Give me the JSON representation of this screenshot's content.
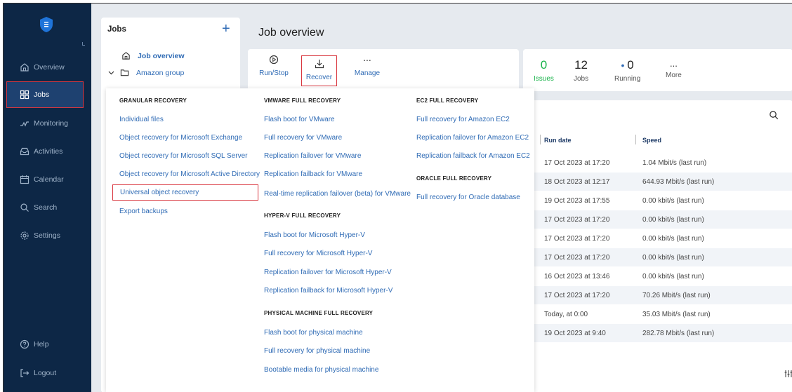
{
  "colors": {
    "sidebar_bg": "#0d2746",
    "accent": "#2f6bb5",
    "issues_green": "#19b34a",
    "highlight_red": "#d9363e"
  },
  "sidebar": {
    "items": [
      {
        "label": "Overview",
        "icon": "home-icon"
      },
      {
        "label": "Jobs",
        "icon": "grid-icon",
        "active": true
      },
      {
        "label": "Monitoring",
        "icon": "pulse-icon"
      },
      {
        "label": "Activities",
        "icon": "inbox-icon"
      },
      {
        "label": "Calendar",
        "icon": "calendar-icon"
      },
      {
        "label": "Search",
        "icon": "search-icon"
      },
      {
        "label": "Settings",
        "icon": "gear-icon"
      }
    ],
    "bottom": [
      {
        "label": "Help",
        "icon": "help-icon"
      },
      {
        "label": "Logout",
        "icon": "logout-icon"
      }
    ]
  },
  "jobs_panel": {
    "title": "Jobs",
    "add_label": "+",
    "tree": [
      {
        "label": "Job overview",
        "icon": "home-icon"
      },
      {
        "label": "Amazon group",
        "icon": "folder-icon"
      }
    ]
  },
  "page": {
    "title": "Job overview"
  },
  "toolbar": {
    "run_stop": "Run/Stop",
    "recover": "Recover",
    "manage": "Manage",
    "manage_dots": "..."
  },
  "stats": {
    "issues": {
      "value": "0",
      "label": "Issues"
    },
    "jobs": {
      "value": "12",
      "label": "Jobs"
    },
    "running": {
      "value": "0",
      "label": "Running"
    },
    "more": {
      "value": "...",
      "label": "More"
    }
  },
  "table": {
    "columns": [
      "Run date",
      "Speed"
    ],
    "rows": [
      {
        "run_date": "17 Oct 2023 at 17:20",
        "speed": "1.04 Mbit/s (last run)"
      },
      {
        "run_date": "18 Oct 2023 at 12:17",
        "speed": "644.93 Mbit/s (last run)"
      },
      {
        "run_date": "19 Oct 2023 at 17:55",
        "speed": "0.00 kbit/s (last run)"
      },
      {
        "run_date": "17 Oct 2023 at 17:20",
        "speed": "0.00 kbit/s (last run)"
      },
      {
        "run_date": "17 Oct 2023 at 17:20",
        "speed": "0.00 kbit/s (last run)"
      },
      {
        "run_date": "17 Oct 2023 at 17:20",
        "speed": "0.00 kbit/s (last run)"
      },
      {
        "run_date": "16 Oct 2023 at 13:46",
        "speed": "0.00 kbit/s (last run)"
      },
      {
        "run_date": "17 Oct 2023 at 17:20",
        "speed": "70.26 Mbit/s (last run)"
      },
      {
        "run_date": "Today, at 0:00",
        "speed": "35.03 Mbit/s (last run)"
      },
      {
        "run_date": "19 Oct 2023 at 9:40",
        "speed": "282.78 Mbit/s (last run)"
      }
    ]
  },
  "recover_menu": {
    "granular": {
      "heading": "GRANULAR RECOVERY",
      "items": [
        "Individual files",
        "Object recovery for Microsoft Exchange",
        "Object recovery for Microsoft SQL Server",
        "Object recovery for Microsoft Active Directory",
        "Universal object recovery",
        "Export backups"
      ]
    },
    "vmware": {
      "heading": "VMWARE FULL RECOVERY",
      "items": [
        "Flash boot for VMware",
        "Full recovery for VMware",
        "Replication failover for VMware",
        "Replication failback for VMware",
        "Real-time replication failover (beta) for VMware"
      ]
    },
    "hyperv": {
      "heading": "HYPER-V FULL RECOVERY",
      "items": [
        "Flash boot for Microsoft Hyper-V",
        "Full recovery for Microsoft Hyper-V",
        "Replication failover for Microsoft Hyper-V",
        "Replication failback for Microsoft Hyper-V"
      ]
    },
    "physical": {
      "heading": "PHYSICAL MACHINE FULL RECOVERY",
      "items": [
        "Flash boot for physical machine",
        "Full recovery for physical machine",
        "Bootable media for physical machine"
      ]
    },
    "ec2": {
      "heading": "EC2 FULL RECOVERY",
      "items": [
        "Full recovery for Amazon EC2",
        "Replication failover for Amazon EC2",
        "Replication failback for Amazon EC2"
      ]
    },
    "oracle": {
      "heading": "ORACLE FULL RECOVERY",
      "items": [
        "Full recovery for Oracle database"
      ]
    }
  }
}
